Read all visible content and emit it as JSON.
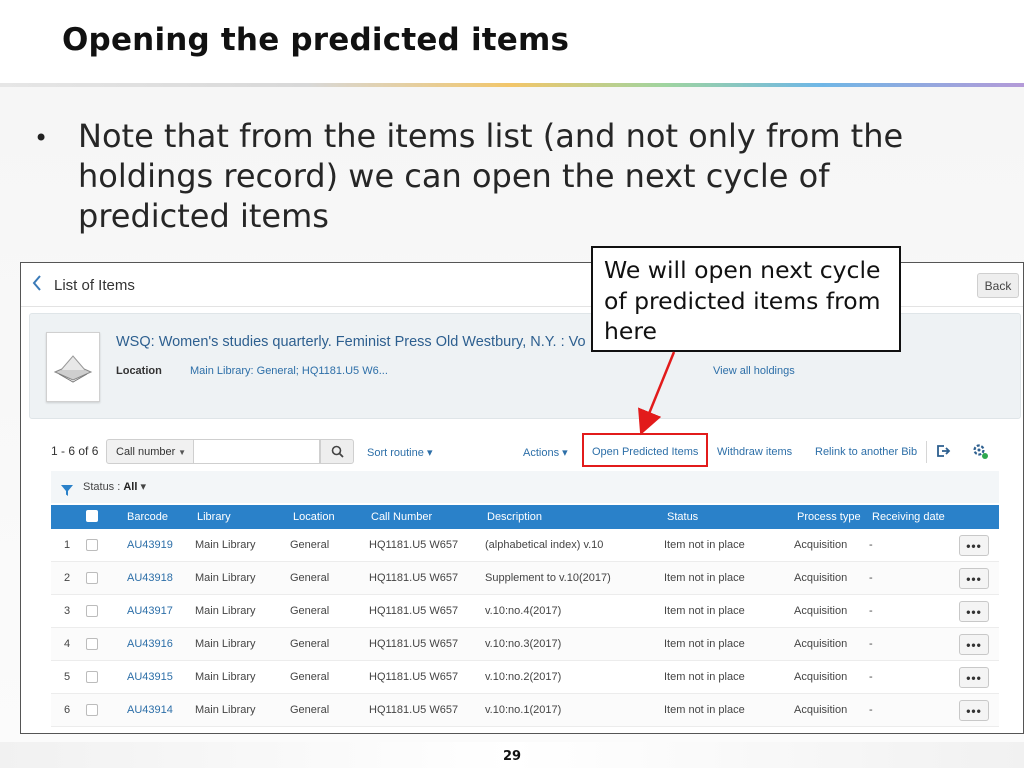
{
  "slide": {
    "title": "Opening the predicted items",
    "bullet": "Note that from the items list (and not only from the holdings record) we can open the next cycle of predicted items",
    "bullet_marker": "•",
    "callout": "We will open next cycle of predicted items from here",
    "page_number": "29",
    "highlight_color": "#e21b1b"
  },
  "app": {
    "header": {
      "back_icon": "chevron-left-icon",
      "title": "List of Items",
      "back_label": "Back"
    },
    "record": {
      "title": "WSQ: Women's studies quarterly. Feminist Press Old Westbury, N.Y. : Vo",
      "location_label": "Location",
      "location_value": "Main Library: General; HQ1181.U5 W6...",
      "view_holdings": "View all holdings"
    },
    "toolbar": {
      "count": "1 - 6 of 6",
      "search_scope": "Call number",
      "search_placeholder": "",
      "sort_label": "Sort routine",
      "actions_label": "Actions",
      "open_predicted_label": "Open Predicted Items",
      "withdraw_label": "Withdraw items",
      "relink_label": "Relink to another Bib"
    },
    "filter": {
      "label": "Status :",
      "value": "All"
    },
    "table": {
      "columns": [
        "Barcode",
        "Library",
        "Location",
        "Call Number",
        "Description",
        "Status",
        "Process type",
        "Receiving date"
      ],
      "rows": [
        {
          "n": "1",
          "barcode": "AU43919",
          "library": "Main Library",
          "location": "General",
          "call": "HQ1181.U5 W657",
          "desc": "(alphabetical index) v.10",
          "status": "Item not in place",
          "process": "Acquisition",
          "received": "-"
        },
        {
          "n": "2",
          "barcode": "AU43918",
          "library": "Main Library",
          "location": "General",
          "call": "HQ1181.U5 W657",
          "desc": "Supplement to v.10(2017)",
          "status": "Item not in place",
          "process": "Acquisition",
          "received": "-"
        },
        {
          "n": "3",
          "barcode": "AU43917",
          "library": "Main Library",
          "location": "General",
          "call": "HQ1181.U5 W657",
          "desc": "v.10:no.4(2017)",
          "status": "Item not in place",
          "process": "Acquisition",
          "received": "-"
        },
        {
          "n": "4",
          "barcode": "AU43916",
          "library": "Main Library",
          "location": "General",
          "call": "HQ1181.U5 W657",
          "desc": "v.10:no.3(2017)",
          "status": "Item not in place",
          "process": "Acquisition",
          "received": "-"
        },
        {
          "n": "5",
          "barcode": "AU43915",
          "library": "Main Library",
          "location": "General",
          "call": "HQ1181.U5 W657",
          "desc": "v.10:no.2(2017)",
          "status": "Item not in place",
          "process": "Acquisition",
          "received": "-"
        },
        {
          "n": "6",
          "barcode": "AU43914",
          "library": "Main Library",
          "location": "General",
          "call": "HQ1181.U5 W657",
          "desc": "v.10:no.1(2017)",
          "status": "Item not in place",
          "process": "Acquisition",
          "received": "-"
        }
      ],
      "more_label": "•••"
    }
  }
}
